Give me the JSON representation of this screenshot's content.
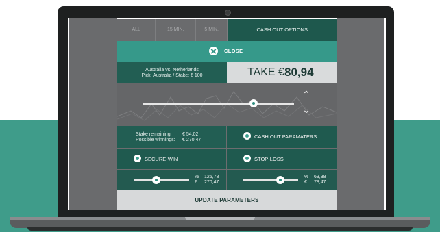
{
  "tabs": [
    {
      "label": "ALL"
    },
    {
      "label": "15 MIN."
    },
    {
      "label": "5 MIN."
    },
    {
      "label": "CASH OUT OPTIONS"
    }
  ],
  "close": {
    "label": "CLOSE"
  },
  "match": {
    "title": "Australia vs. Netherlands",
    "subtitle": "Pick: Australia / Stake: € 100"
  },
  "take": {
    "label": "TAKE €",
    "value": "80,94"
  },
  "main_slider": {
    "level": 0.73
  },
  "stake": {
    "remaining_label": "Stake remaining:",
    "remaining_value": "€   54,02",
    "winnings_label": "Possible winnings:",
    "winnings_value": "€  270,47"
  },
  "options": {
    "cashout": "CASH OUT PARAMATERS",
    "secure": "SECURE-WIN",
    "stop": "STOP-LOSS"
  },
  "secure_slider": {
    "level": 0.4,
    "pct_sym": "%",
    "pct": "125,78",
    "eur_sym": "€",
    "eur": "270,47"
  },
  "stop_slider": {
    "level": 0.68,
    "pct_sym": "%",
    "pct": "63,38",
    "eur_sym": "€",
    "eur": "78,47"
  },
  "update": {
    "label": "UPDATE PARAMETERS"
  },
  "colors": {
    "teal": "#36998a",
    "dark_green": "#225e53",
    "accent_band": "#3f9c8a"
  }
}
